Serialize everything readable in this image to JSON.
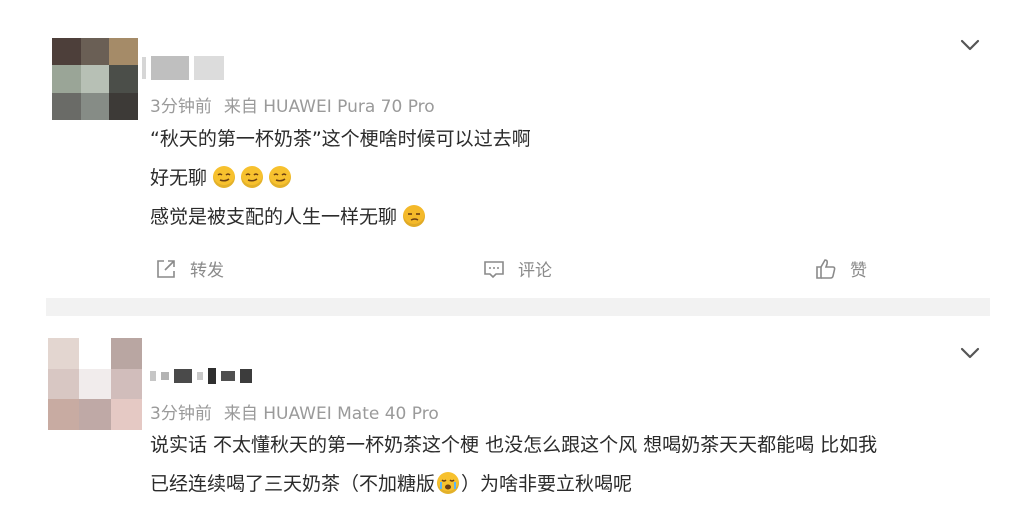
{
  "posts": [
    {
      "meta": {
        "time": "3分钟前",
        "source": "来自 HUAWEI Pura 70 Pro"
      },
      "lines": [
        "“秋天的第一杯奶茶”这个梗啥时候可以过去啊",
        "好无聊",
        "感觉是被支配的人生一样无聊"
      ],
      "actions": {
        "repost": "转发",
        "comment": "评论",
        "like": "赞"
      },
      "emoji": [
        "smug-face-icon",
        "smug-face-icon",
        "smug-face-icon",
        "sneer-face-icon"
      ]
    },
    {
      "meta": {
        "time": "3分钟前",
        "source": "来自 HUAWEI Mate 40 Pro"
      },
      "lines": [
        "说实话 不太懂秋天的第一杯奶茶这个梗 也没怎么跟这个风 想喝奶茶天天都能喝 比如我",
        "已经连续喝了三天奶茶（不加糖版",
        "）为啥非要立秋喝呢"
      ],
      "emoji": [
        "crying-face-icon"
      ]
    }
  ],
  "colors": {
    "text": "#2b2b2b",
    "meta": "#9a9a9a",
    "separator": "#f2f2f2",
    "emoji": "#f7c12e"
  }
}
